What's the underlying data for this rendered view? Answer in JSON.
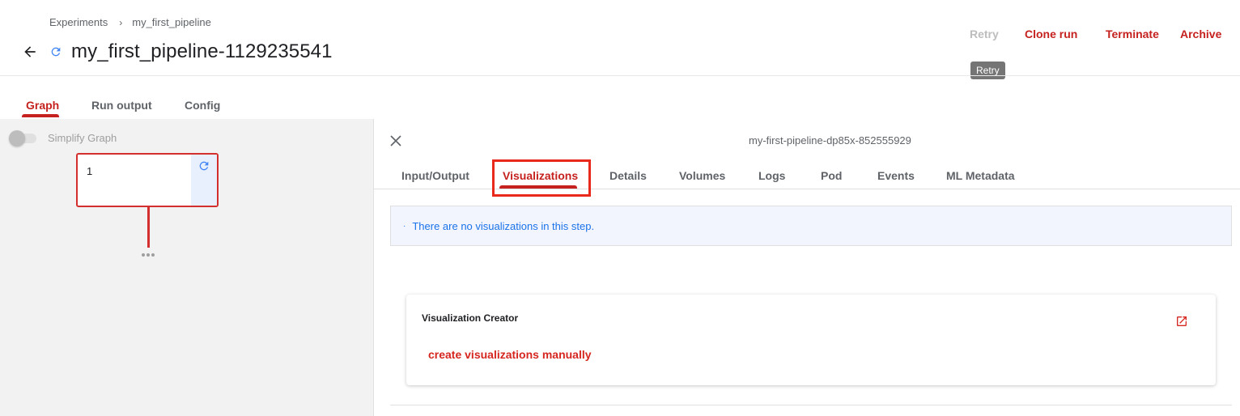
{
  "breadcrumb": {
    "items": [
      "Experiments",
      "my_first_pipeline"
    ],
    "separator": "›"
  },
  "header": {
    "title": "my_first_pipeline-1129235541",
    "status_icon": "running-refresh-icon",
    "back_icon": "arrow-back-icon"
  },
  "actions": {
    "retry": "Retry",
    "clone_run": "Clone run",
    "terminate": "Terminate",
    "archive": "Archive",
    "tooltip": "Retry"
  },
  "top_tabs": [
    "Graph",
    "Run output",
    "Config"
  ],
  "active_top_tab": "Graph",
  "graph": {
    "simplify_label": "Simplify Graph",
    "simplify_enabled": false,
    "node_label": "1",
    "node_status_icon": "running-refresh-icon",
    "more_icon": "more-horizontal-icon"
  },
  "side_panel": {
    "step_name": "my-first-pipeline-dp85x-852555929",
    "tabs": [
      "Input/Output",
      "Visualizations",
      "Details",
      "Volumes",
      "Logs",
      "Pod",
      "Events",
      "ML Metadata"
    ],
    "active_tab": "Visualizations",
    "info_bullet": "·",
    "info_message": "There are no visualizations in this step.",
    "card": {
      "title": "Visualization Creator",
      "link": "create visualizations manually",
      "open_icon": "open-in-new-icon"
    }
  },
  "colors": {
    "accent": "#c5221f",
    "info_text": "#1a73e8",
    "info_bg": "#f3f5fe",
    "highlight_box": "#e8291c",
    "graph_bg": "#f2f2f2"
  }
}
